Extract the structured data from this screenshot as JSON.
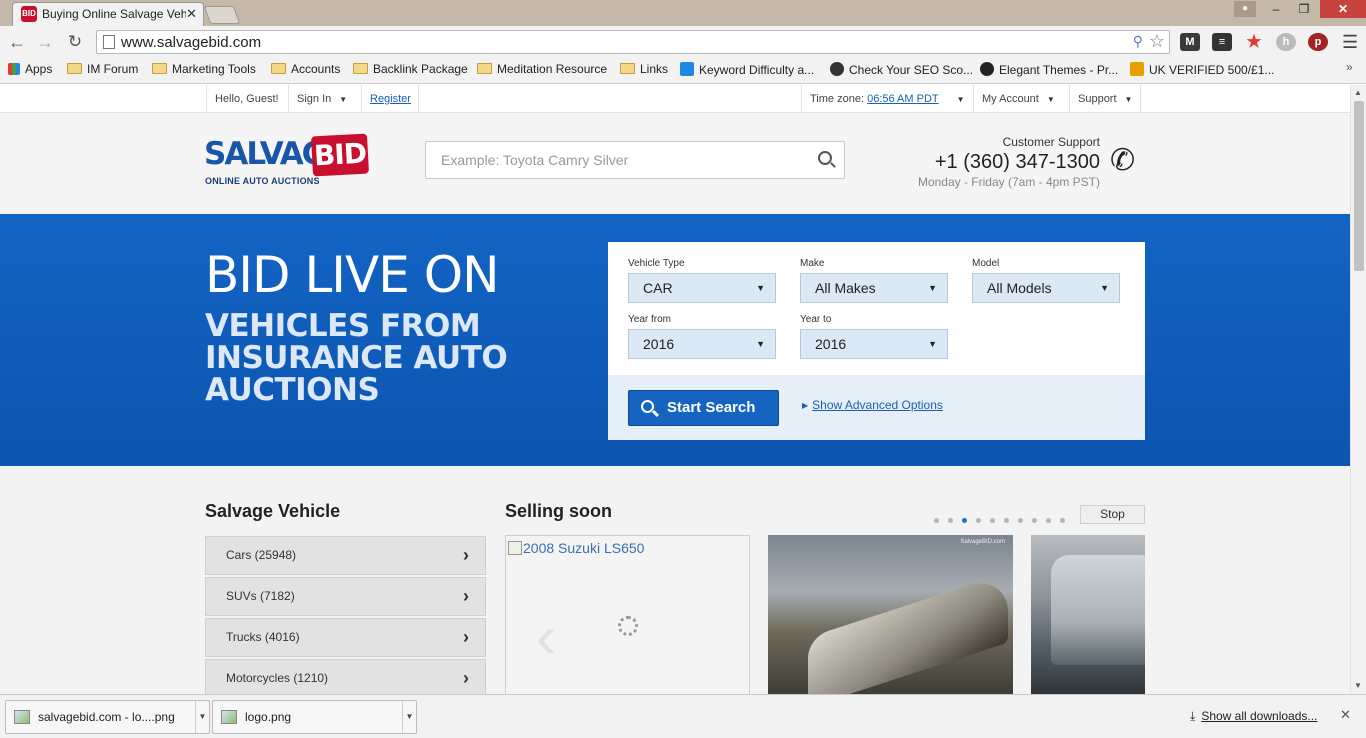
{
  "browser": {
    "tab_title": "Buying Online Salvage Vehi",
    "tab_favicon": "BID",
    "url": "www.salvagebid.com",
    "bookmarks": [
      {
        "label": "Apps",
        "icon": "apps-grid-icon"
      },
      {
        "label": "IM Forum",
        "icon": "folder-icon"
      },
      {
        "label": "Marketing Tools",
        "icon": "folder-icon"
      },
      {
        "label": "Accounts",
        "icon": "folder-icon"
      },
      {
        "label": "Backlink Package",
        "icon": "folder-icon"
      },
      {
        "label": "Meditation Resource",
        "icon": "folder-icon"
      },
      {
        "label": "Links",
        "icon": "folder-icon"
      },
      {
        "label": "Keyword Difficulty a...",
        "icon": "moz-icon"
      },
      {
        "label": "Check Your SEO Sco...",
        "icon": "seo-score-icon"
      },
      {
        "label": "Elegant Themes - Pr...",
        "icon": "elegant-themes-icon"
      },
      {
        "label": "UK VERIFIED 500/£1...",
        "icon": "verified-icon"
      }
    ],
    "more": "»"
  },
  "utilbar": {
    "greeting": "Hello, Guest!",
    "sign_in": "Sign In",
    "register": "Register",
    "timezone_label": "Time zone:",
    "timezone_value": "06:56 AM PDT",
    "my_account": "My Account",
    "support": "Support"
  },
  "header": {
    "logo_word": "SALVAGE",
    "logo_bid": "BID",
    "logo_sub": "ONLINE AUTO AUCTIONS",
    "search_placeholder": "Example: Toyota Camry Silver",
    "support_label": "Customer Support",
    "support_phone": "+1 (360) 347-1300",
    "support_hours": "Monday - Friday (7am - 4pm PST)"
  },
  "hero": {
    "title": "BID LIVE ON",
    "subtitle": "VEHICLES FROM INSURANCE AUTO AUCTIONS"
  },
  "search_panel": {
    "vehicle_type": {
      "label": "Vehicle Type",
      "value": "CAR"
    },
    "make": {
      "label": "Make",
      "value": "All Makes"
    },
    "model": {
      "label": "Model",
      "value": "All Models"
    },
    "year_from": {
      "label": "Year from",
      "value": "2016"
    },
    "year_to": {
      "label": "Year to",
      "value": "2016"
    },
    "start_search": "Start Search",
    "advanced": "Show Advanced Options"
  },
  "salvage": {
    "title": "Salvage Vehicle",
    "items": [
      {
        "label": "Cars (25948)"
      },
      {
        "label": "SUVs (7182)"
      },
      {
        "label": "Trucks (4016)"
      },
      {
        "label": "Motorcycles (1210)"
      }
    ]
  },
  "selling_soon": {
    "title": "Selling soon",
    "stop": "Stop",
    "dot_count": 10,
    "active_dot": 2,
    "card1_alt": "2008 Suzuki LS650",
    "card2_watermark": "SalvageBID.com"
  },
  "downloads": {
    "items": [
      {
        "name": "salvagebid.com - lo....png"
      },
      {
        "name": "logo.png"
      }
    ],
    "show_all": "Show all downloads..."
  }
}
